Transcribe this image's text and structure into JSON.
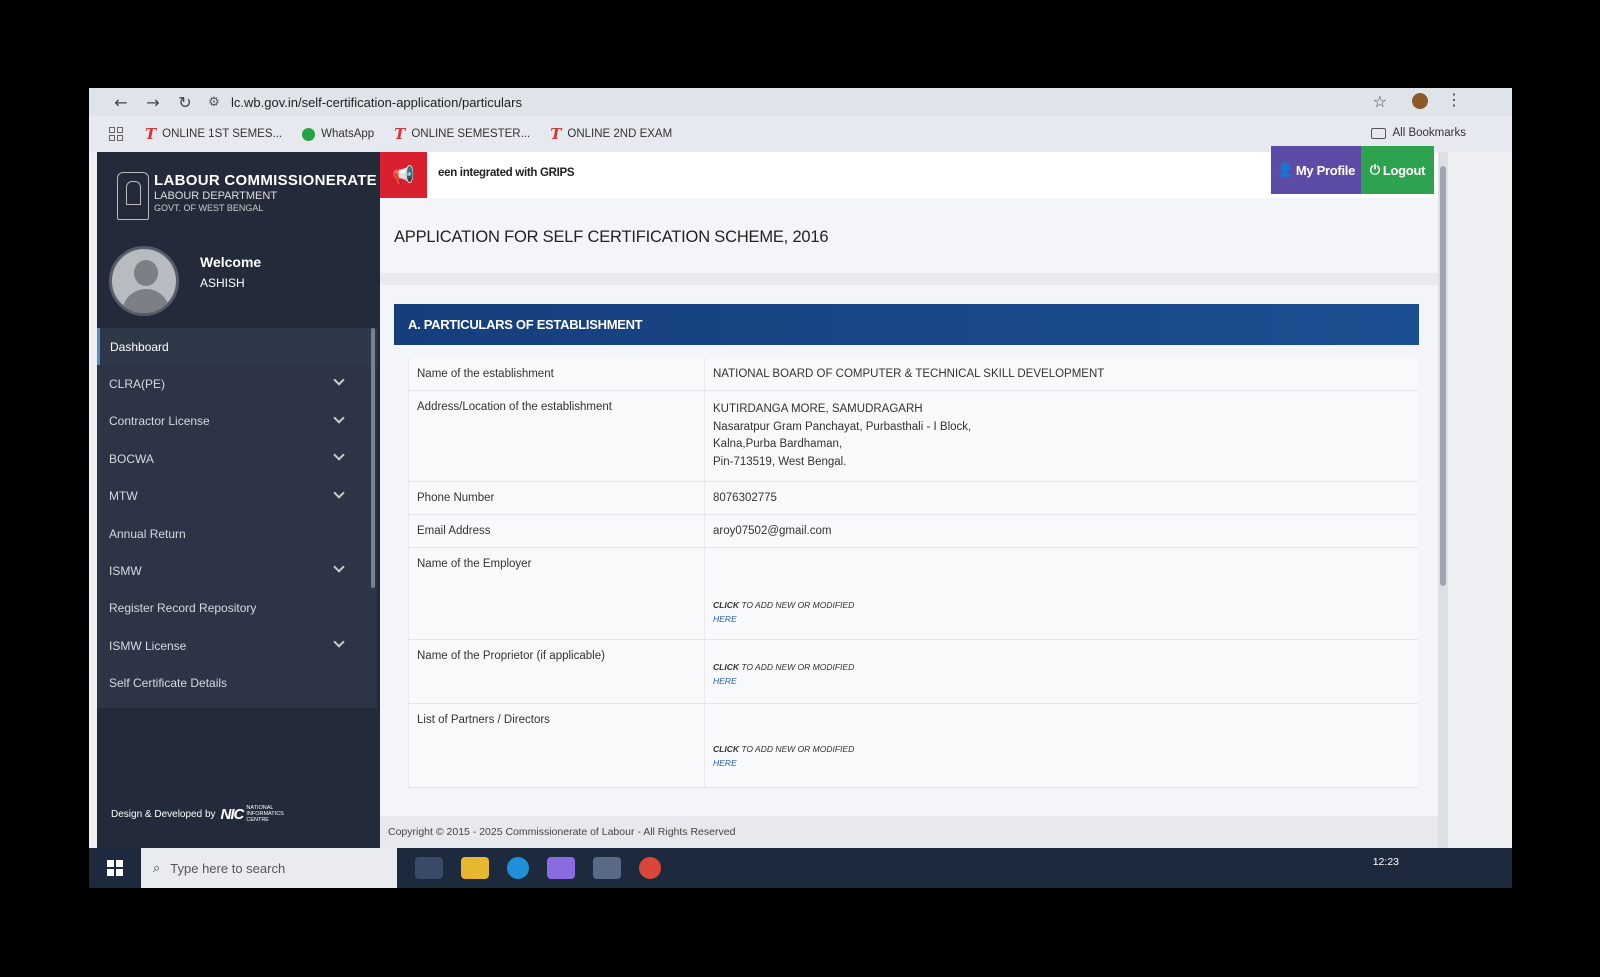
{
  "browser": {
    "url": "lc.wb.gov.in/self-certification-application/particulars",
    "bookmarks": [
      {
        "label": "ONLINE 1ST SEMES..."
      },
      {
        "label": "WhatsApp"
      },
      {
        "label": "ONLINE SEMESTER..."
      },
      {
        "label": "ONLINE 2ND EXAM"
      }
    ],
    "all_bookmarks": "All Bookmarks"
  },
  "sidebar": {
    "brand_title": "LABOUR COMMISSIONERATE",
    "brand_sub1": "LABOUR DEPARTMENT",
    "brand_sub2": "GOVT. OF WEST BENGAL",
    "welcome": "Welcome",
    "username": "ASHISH",
    "items": [
      {
        "label": "Dashboard",
        "has_children": false,
        "active": true
      },
      {
        "label": "CLRA(PE)",
        "has_children": true
      },
      {
        "label": "Contractor License",
        "has_children": true
      },
      {
        "label": "BOCWA",
        "has_children": true
      },
      {
        "label": "MTW",
        "has_children": true
      },
      {
        "label": "Annual Return",
        "has_children": false
      },
      {
        "label": "ISMW",
        "has_children": true
      },
      {
        "label": "Register Record Repository",
        "has_children": false
      },
      {
        "label": "ISMW License",
        "has_children": true
      },
      {
        "label": "Self Certificate Details",
        "has_children": false
      }
    ],
    "credit": "Design & Developed by",
    "credit_logo": "NIC",
    "credit_logo_sub": "NATIONAL INFORMATICS CENTRE"
  },
  "topbar": {
    "ticker": "een integrated with GRIPS",
    "profile_label": "My Profile",
    "logout_label": "Logout"
  },
  "page": {
    "title": "APPLICATION FOR SELF CERTIFICATION SCHEME, 2016",
    "section_title": "A. PARTICULARS OF ESTABLISHMENT",
    "rows": [
      {
        "label": "Name of the establishment",
        "value": "NATIONAL BOARD OF COMPUTER & TECHNICAL SKILL DEVELOPMENT"
      },
      {
        "label": "Address/Location of the establishment",
        "address": [
          "KUTIRDANGA MORE, SAMUDRAGARH",
          "Nasaratpur Gram Panchayat, Purbasthali - I Block,",
          "Kalna,Purba Bardhaman,",
          "Pin-713519, West Bengal."
        ]
      },
      {
        "label": "Phone Number",
        "value": "8076302775"
      },
      {
        "label": "Email Address",
        "value": "aroy07502@gmail.com"
      },
      {
        "label": "Name of the Employer"
      },
      {
        "label": "Name of the Proprietor (if applicable)"
      },
      {
        "label": "List of Partners / Directors"
      }
    ],
    "click_bold": "CLICK",
    "click_rest": "TO ADD NEW OR MODIFIED",
    "click_here": "HERE",
    "footer": "Copyright © 2015 - 2025 Commissionerate of Labour - All Rights Reserved"
  },
  "taskbar": {
    "search_placeholder": "Type here to search",
    "time": "12:23"
  }
}
